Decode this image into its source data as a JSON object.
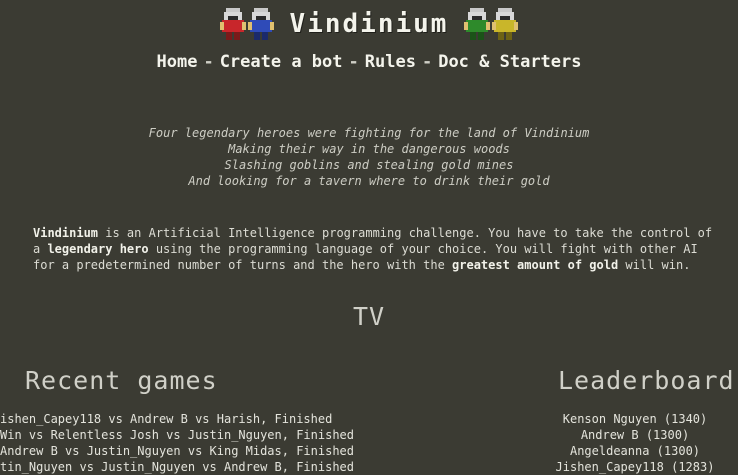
{
  "site": {
    "title": "Vindinium"
  },
  "nav": {
    "items": [
      {
        "label": "Home"
      },
      {
        "label": "Create a bot"
      },
      {
        "label": "Rules"
      },
      {
        "label": "Doc & Starters"
      }
    ],
    "separator": "-"
  },
  "poem": {
    "lines": [
      "Four legendary heroes were fighting for the land of Vindinium",
      "Making their way in the dangerous woods",
      "Slashing goblins and stealing gold mines",
      "And looking for a tavern where to drink their gold"
    ]
  },
  "intro": {
    "part1_bold": "Vindinium",
    "part2": " is an Artificial Intelligence programming challenge. You have to take the control of a ",
    "part3_bold": "legendary hero",
    "part4": " using the programming language of your choice. You will fight with other AI for a predetermined number of turns and the hero with the ",
    "part5_bold": "greatest amount of gold",
    "part6": " will win."
  },
  "tv": {
    "title": "TV"
  },
  "recent_games": {
    "title": "Recent games",
    "items": [
      "ishen_Capey118 vs Andrew B vs Harish, Finished",
      "Win vs Relentless Josh vs Justin_Nguyen, Finished",
      "Andrew B vs Justin_Nguyen vs King Midas, Finished",
      "tin_Nguyen vs Justin_Nguyen vs Andrew B, Finished"
    ]
  },
  "leaderboard": {
    "title": "Leaderboard",
    "items": [
      "Kenson Nguyen (1340)",
      "Andrew B (1300)",
      "Angeldeanna (1300)",
      "Jishen_Capey118 (1283)"
    ]
  },
  "colors": {
    "background": "#3b3b33",
    "hero_red": "#c8262b",
    "hero_blue": "#2f4bb8",
    "hero_green": "#2e8a2b",
    "hero_yellow": "#c9b62a",
    "helmet": "#c9c9c9"
  }
}
